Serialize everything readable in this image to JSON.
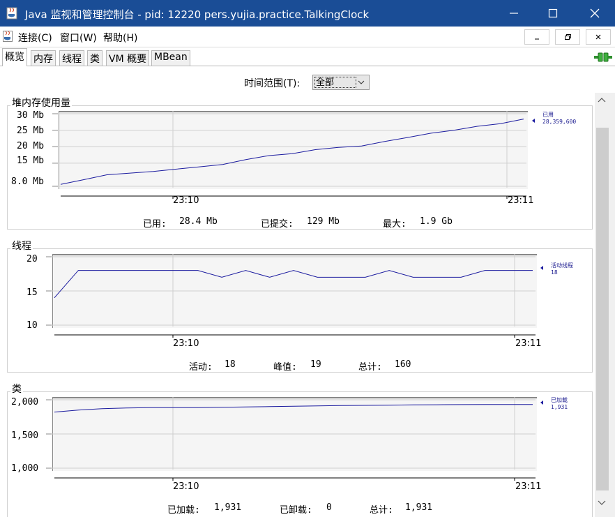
{
  "window": {
    "title": "Java 监视和管理控制台 - pid: 12220 pers.yujia.practice.TalkingClock"
  },
  "menu": {
    "items": [
      "连接(C)",
      "窗口(W)",
      "帮助(H)"
    ]
  },
  "tabs": [
    "概览",
    "内存",
    "线程",
    "类",
    "VM 概要",
    "MBean"
  ],
  "time_range": {
    "label": "时间范围(T):",
    "value": "全部"
  },
  "heap": {
    "title": "堆内存使用量",
    "legend_name": "已用",
    "legend_value": "28,359,600",
    "stats": {
      "used_label": "已用:",
      "used_value": "28.4 Mb",
      "committed_label": "已提交:",
      "committed_value": "129 Mb",
      "max_label": "最大:",
      "max_value": "1.9 Gb"
    }
  },
  "threads": {
    "title": "线程",
    "legend_name": "活动线程",
    "legend_value": "18",
    "stats": {
      "live_label": "活动:",
      "live_value": "18",
      "peak_label": "峰值:",
      "peak_value": "19",
      "total_label": "总计:",
      "total_value": "160"
    }
  },
  "classes": {
    "title": "类",
    "legend_name": "已加载",
    "legend_value": "1,931",
    "stats": {
      "loaded_label": "已加载:",
      "loaded_value": "1,931",
      "unloaded_label": "已卸载:",
      "unloaded_value": "0",
      "total_label": "总计:",
      "total_value": "1,931"
    }
  },
  "chart_data": [
    {
      "type": "line",
      "name": "heap",
      "x_ticks": [
        "23:10",
        "23:11"
      ],
      "y_ticks": [
        "30 Mb",
        "25 Mb",
        "20 Mb",
        "15 Mb",
        "8.0 Mb"
      ],
      "y_tick_values": [
        30,
        25,
        20,
        15,
        8
      ],
      "ylim": [
        8,
        30
      ],
      "x": [
        0,
        1,
        2,
        3,
        4,
        5,
        6,
        7,
        8,
        9,
        10,
        11,
        12,
        13,
        14,
        15,
        16,
        17,
        18,
        19,
        20
      ],
      "series": [
        {
          "name": "已用",
          "values": [
            8.6,
            10.0,
            11.5,
            12.0,
            12.5,
            13.2,
            13.9,
            14.6,
            16.1,
            17.3,
            17.9,
            19.1,
            19.8,
            20.2,
            21.6,
            22.8,
            24.1,
            25.0,
            26.2,
            27.0,
            28.4
          ]
        }
      ],
      "grid": true
    },
    {
      "type": "line",
      "name": "threads",
      "x_ticks": [
        "23:10",
        "23:11"
      ],
      "y_ticks": [
        "20",
        "15",
        "10"
      ],
      "y_tick_values": [
        20,
        15,
        10
      ],
      "ylim": [
        10,
        20
      ],
      "x": [
        0,
        1,
        2,
        3,
        4,
        5,
        6,
        7,
        8,
        9,
        10,
        11,
        12,
        13,
        14,
        15,
        16,
        17,
        18,
        19,
        20
      ],
      "series": [
        {
          "name": "活动线程",
          "values": [
            14,
            18,
            18,
            18,
            18,
            18,
            18,
            17,
            18,
            17,
            18,
            17,
            17,
            17,
            18,
            17,
            17,
            17,
            18,
            18,
            18
          ]
        }
      ],
      "grid": true
    },
    {
      "type": "line",
      "name": "classes",
      "x_ticks": [
        "23:10",
        "23:11"
      ],
      "y_ticks": [
        "2,000",
        "1,500",
        "1,000"
      ],
      "y_tick_values": [
        2000,
        1500,
        1000
      ],
      "ylim": [
        1000,
        2000
      ],
      "x": [
        0,
        1,
        2,
        3,
        4,
        5,
        6,
        7,
        8,
        9,
        10,
        11,
        12,
        13,
        14,
        15,
        16,
        17,
        18,
        19,
        20
      ],
      "series": [
        {
          "name": "已加载",
          "values": [
            1820,
            1850,
            1870,
            1880,
            1885,
            1885,
            1885,
            1890,
            1895,
            1900,
            1905,
            1910,
            1915,
            1918,
            1920,
            1925,
            1928,
            1930,
            1931,
            1931,
            1931
          ]
        }
      ],
      "grid": true
    }
  ]
}
